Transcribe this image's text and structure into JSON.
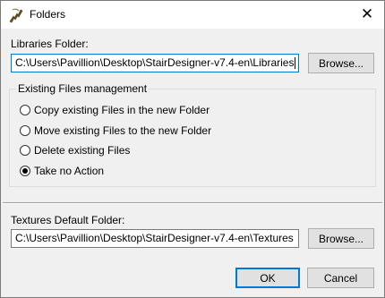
{
  "window": {
    "title": "Folders",
    "close_glyph": "✕"
  },
  "libraries": {
    "label": "Libraries Folder:",
    "value": "C:\\Users\\Pavillion\\Desktop\\StairDesigner-v7.4-en\\Libraries",
    "browse_label": "Browse..."
  },
  "existing_files": {
    "title": "Existing Files management",
    "options": [
      {
        "label": "Copy existing Files in the new Folder",
        "checked": false
      },
      {
        "label": "Move existing Files to the new Folder",
        "checked": false
      },
      {
        "label": "Delete existing Files",
        "checked": false
      },
      {
        "label": "Take no Action",
        "checked": true
      }
    ]
  },
  "textures": {
    "label": "Textures Default Folder:",
    "value": "C:\\Users\\Pavillion\\Desktop\\StairDesigner-v7.4-en\\Textures",
    "browse_label": "Browse..."
  },
  "buttons": {
    "ok_label": "OK",
    "cancel_label": "Cancel"
  },
  "colors": {
    "focus": "#0078d7",
    "dialog_bg": "#f0f0f0",
    "button_bg": "#e1e1e1"
  },
  "icons": {
    "app": "stair-designer-app-icon",
    "close": "close-icon"
  }
}
